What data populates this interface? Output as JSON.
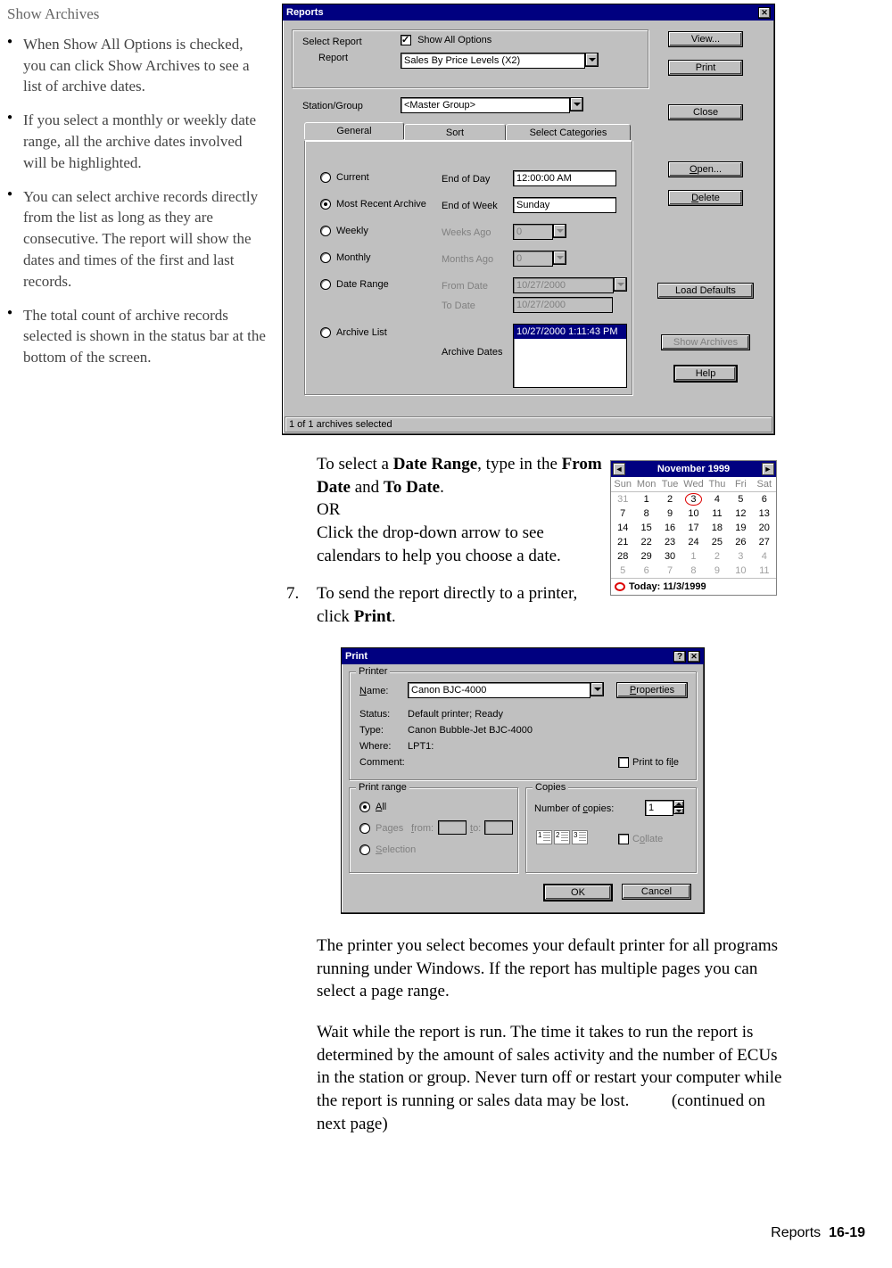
{
  "sidebar": {
    "title": "Show Archives",
    "bullets": [
      "When Show All Options is checked, you can click Show Archives to see a list of archive dates.",
      "If you select a monthly or weekly date range, all the archive dates involved will be highlighted.",
      "You can select archive records directly from the list as long as they are consecutive. The report will show the dates and times of the first and last records.",
      "The total count of archive records selected is shown in the status bar at the bottom of the screen."
    ]
  },
  "reportsDialog": {
    "title": "Reports",
    "labels": {
      "selectReport": "Select Report",
      "report": "Report",
      "stationGroup": "Station/Group",
      "endOfDay": "End of Day",
      "endOfWeek": "End of Week",
      "weeksAgo": "Weeks Ago",
      "monthsAgo": "Months Ago",
      "fromDate": "From Date",
      "toDate": "To Date",
      "archiveDates": "Archive Dates"
    },
    "checkbox": {
      "showAllOptions": "Show All Options"
    },
    "reportValue": "Sales By Price Levels (X2)",
    "stationGroupValue": "<Master Group>",
    "tabs": {
      "general": "General",
      "sort": "Sort",
      "selectCategories": "Select Categories"
    },
    "radios": {
      "current": "Current",
      "mostRecentArchive": "Most Recent Archive",
      "weekly": "Weekly",
      "monthly": "Monthly",
      "dateRange": "Date Range",
      "archiveList": "Archive List"
    },
    "fields": {
      "endOfDay": "12:00:00 AM",
      "endOfWeek": "Sunday",
      "weeksAgo": "0",
      "monthsAgo": "0",
      "fromDate": "10/27/2000",
      "toDate": "10/27/2000",
      "archiveSelected": "10/27/2000 1:11:43 PM"
    },
    "buttons": {
      "view": "View...",
      "print": "Print",
      "close": "Close",
      "open": "Open...",
      "delete": "Delete",
      "loadDefaults": "Load Defaults",
      "showArchives": "Show Archives",
      "help": "Help"
    },
    "status": "1 of 1 archives selected"
  },
  "dateRangeText": {
    "p1a": "To select a ",
    "p1b": "Date Range",
    "p1c": ", type in the ",
    "p1d": "From Date",
    "p1e": " and ",
    "p1f": "To Date",
    "p1g": ".",
    "or": " OR",
    "p2": "Click the drop-down arrow to see calendars to help you choose a date."
  },
  "step7": {
    "num": "7.",
    "a": "To send the report directly to a printer, click ",
    "b": "Print",
    "c": "."
  },
  "calendar": {
    "title": "November 1999",
    "dayHeaders": [
      "Sun",
      "Mon",
      "Tue",
      "Wed",
      "Thu",
      "Fri",
      "Sat"
    ],
    "weeks": [
      [
        {
          "d": "31",
          "o": true
        },
        {
          "d": "1"
        },
        {
          "d": "2"
        },
        {
          "d": "3",
          "today": true
        },
        {
          "d": "4"
        },
        {
          "d": "5"
        },
        {
          "d": "6"
        }
      ],
      [
        {
          "d": "7"
        },
        {
          "d": "8"
        },
        {
          "d": "9"
        },
        {
          "d": "10"
        },
        {
          "d": "11"
        },
        {
          "d": "12"
        },
        {
          "d": "13"
        }
      ],
      [
        {
          "d": "14"
        },
        {
          "d": "15"
        },
        {
          "d": "16"
        },
        {
          "d": "17"
        },
        {
          "d": "18"
        },
        {
          "d": "19"
        },
        {
          "d": "20"
        }
      ],
      [
        {
          "d": "21"
        },
        {
          "d": "22"
        },
        {
          "d": "23"
        },
        {
          "d": "24"
        },
        {
          "d": "25"
        },
        {
          "d": "26"
        },
        {
          "d": "27"
        }
      ],
      [
        {
          "d": "28"
        },
        {
          "d": "29"
        },
        {
          "d": "30"
        },
        {
          "d": "1",
          "o": true
        },
        {
          "d": "2",
          "o": true
        },
        {
          "d": "3",
          "o": true
        },
        {
          "d": "4",
          "o": true
        }
      ],
      [
        {
          "d": "5",
          "o": true
        },
        {
          "d": "6",
          "o": true
        },
        {
          "d": "7",
          "o": true
        },
        {
          "d": "8",
          "o": true
        },
        {
          "d": "9",
          "o": true
        },
        {
          "d": "10",
          "o": true
        },
        {
          "d": "11",
          "o": true
        }
      ]
    ],
    "today": "Today: 11/3/1999"
  },
  "printDialog": {
    "title": "Print",
    "groups": {
      "printer": "Printer",
      "range": "Print range",
      "copies": "Copies"
    },
    "labels": {
      "name": "Name:",
      "status": "Status:",
      "type": "Type:",
      "where": "Where:",
      "comment": "Comment:",
      "numCopies": "Number of copies:",
      "from": "from:",
      "to": "to:"
    },
    "values": {
      "name": "Canon BJC-4000",
      "status": "Default printer; Ready",
      "type": "Canon Bubble-Jet BJC-4000",
      "where": "LPT1:",
      "copies": "1"
    },
    "checks": {
      "printToFile": "Print to file",
      "collate": "Collate"
    },
    "radios": {
      "all": "All",
      "pages": "Pages",
      "selection": "Selection"
    },
    "buttons": {
      "properties": "Properties",
      "ok": "OK",
      "cancel": "Cancel"
    }
  },
  "afterPrint": {
    "p1": "The printer you select becomes your default printer for all programs running under Windows. If the report has multiple pages you can select a page range.",
    "p2a": "Wait while the report is run. The time it takes to run the report is determined by the amount of sales activity and the number of ECUs in the station or group. Never turn off or restart your computer while the report is running or sales data may be lost.",
    "p2b": "(continued on next page)"
  },
  "footer": {
    "label": "Reports",
    "page": "16-19"
  }
}
